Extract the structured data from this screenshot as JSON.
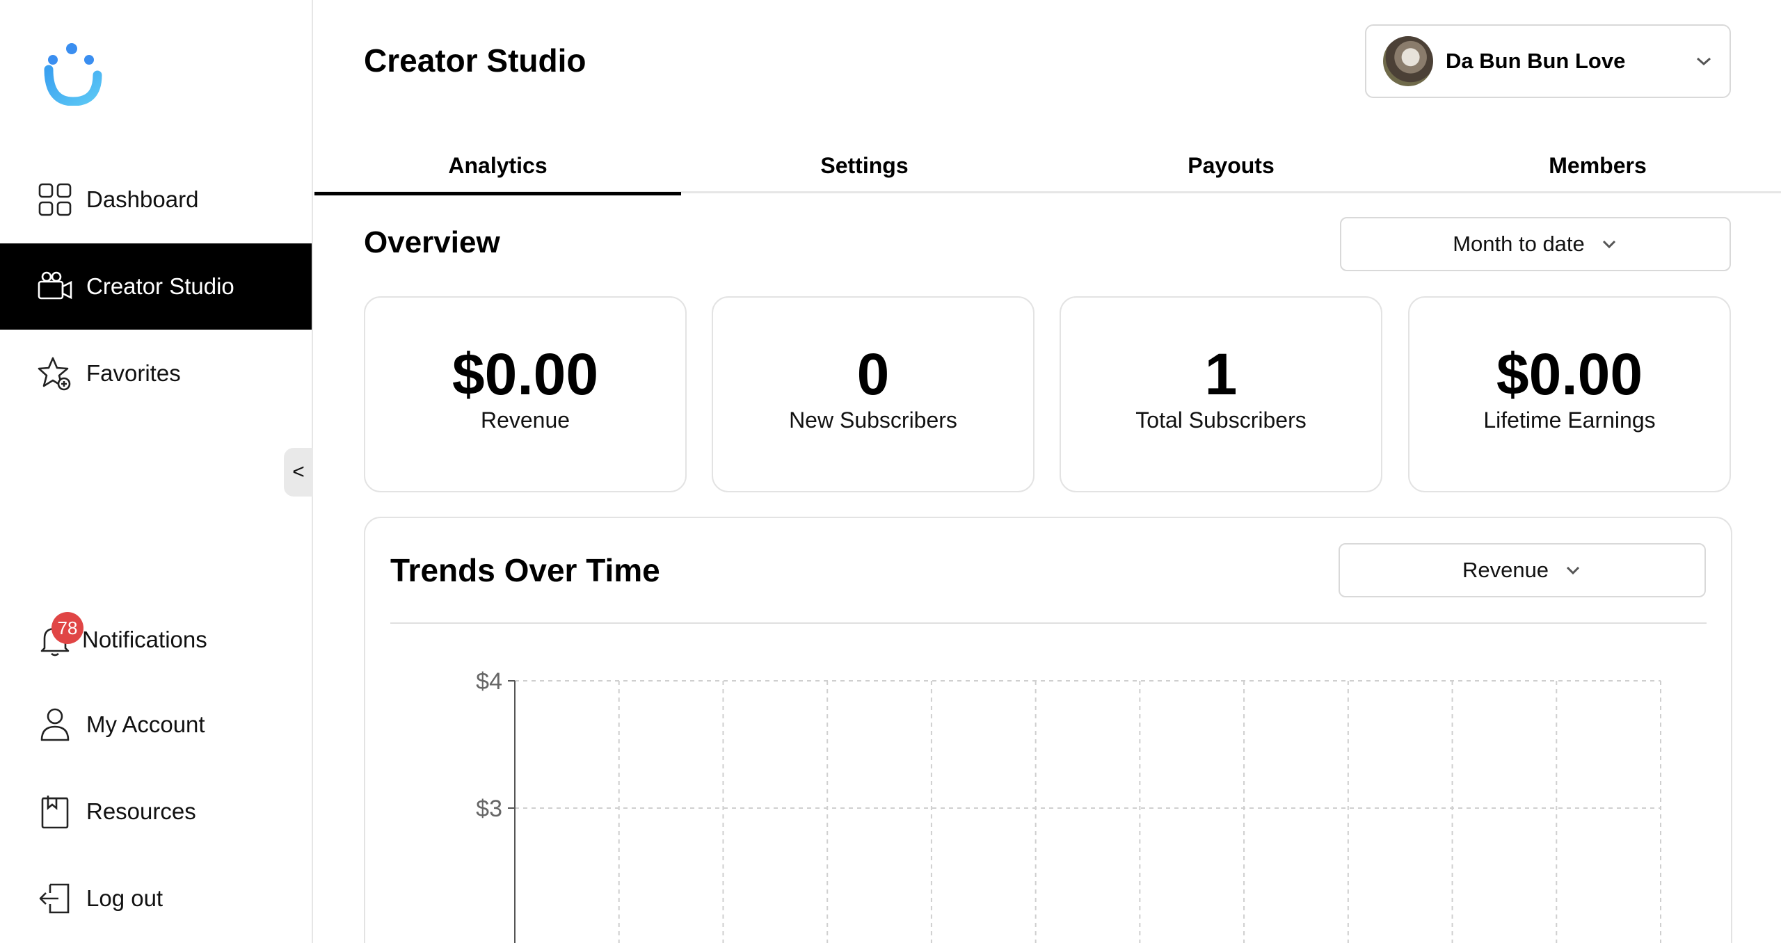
{
  "sidebar": {
    "items": [
      {
        "label": "Dashboard",
        "icon": "grid-icon"
      },
      {
        "label": "Creator Studio",
        "icon": "video-camera-icon",
        "active": true
      },
      {
        "label": "Favorites",
        "icon": "star-add-icon"
      }
    ],
    "bottom_items": [
      {
        "label": "Notifications",
        "icon": "bell-icon",
        "badge": "78"
      },
      {
        "label": "My Account",
        "icon": "user-icon"
      },
      {
        "label": "Resources",
        "icon": "bookmark-book-icon"
      },
      {
        "label": "Log out",
        "icon": "logout-icon"
      }
    ],
    "collapse_label": "<",
    "colors": {
      "active_bg": "#000000",
      "badge": "#e04545"
    }
  },
  "header": {
    "title": "Creator Studio",
    "account_name": "Da Bun Bun Love"
  },
  "tabs": [
    {
      "label": "Analytics",
      "active": true
    },
    {
      "label": "Settings"
    },
    {
      "label": "Payouts"
    },
    {
      "label": "Members"
    }
  ],
  "overview": {
    "title": "Overview",
    "range": "Month to date",
    "stats": [
      {
        "value": "$0.00",
        "label": "Revenue"
      },
      {
        "value": "0",
        "label": "New Subscribers"
      },
      {
        "value": "1",
        "label": "Total Subscribers"
      },
      {
        "value": "$0.00",
        "label": "Lifetime Earnings"
      }
    ]
  },
  "trends": {
    "title": "Trends Over Time",
    "metric": "Revenue"
  },
  "chart_data": {
    "type": "line",
    "y_tick_labels": [
      "$4",
      "$3"
    ],
    "y_ticks": [
      4,
      3
    ],
    "grid": true,
    "series": [],
    "vertical_gridlines": 11
  }
}
